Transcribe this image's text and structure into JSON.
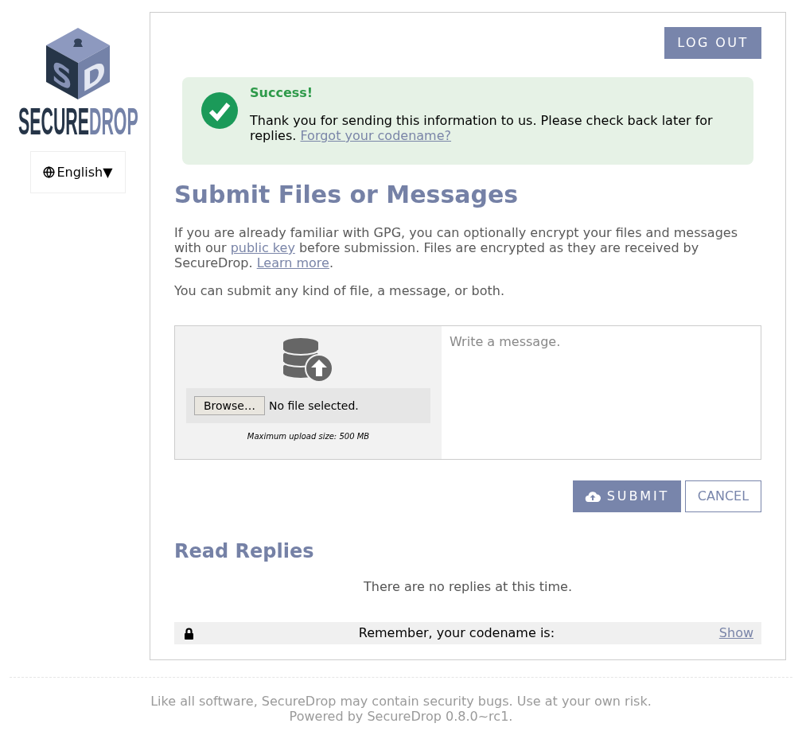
{
  "sidebar": {
    "logo": {
      "cube_letters": [
        "S",
        "D"
      ],
      "wordmark": [
        "SECURE",
        "DROP"
      ]
    },
    "language_menu": {
      "label": "English",
      "caret": "▼"
    }
  },
  "header": {
    "logout_button": "LOG OUT"
  },
  "alert": {
    "kind": "success",
    "title": "Success!",
    "message": "Thank you for sending this information to us. Please check back later for replies.",
    "link": "Forgot your codename?"
  },
  "submit_section": {
    "heading": "Submit Files or Messages",
    "intro": [
      {
        "kind": "text",
        "text": "If you are already familiar with GPG, you can optionally encrypt your files and messages with our "
      },
      {
        "kind": "link",
        "text": "public key"
      },
      {
        "kind": "text",
        "text": " before submission. Files are encrypted as they are received by SecureDrop. "
      },
      {
        "kind": "link",
        "text": "Learn more"
      },
      {
        "kind": "text",
        "text": "."
      }
    ],
    "note": "You can submit any kind of file, a message, or both.",
    "file_picker": {
      "button": "Browse…",
      "status": "No file selected.",
      "limit": "Maximum upload size: 500 MB"
    },
    "message_field": {
      "placeholder": "Write a message."
    },
    "buttons": [
      {
        "kind": "primary",
        "label": "SUBMIT"
      },
      {
        "kind": "secondary",
        "label": "CANCEL"
      }
    ]
  },
  "replies_section": {
    "heading": "Read Replies",
    "empty_text": "There are no replies at this time.",
    "codename_bar": {
      "text": "Remember, your codename is:",
      "link": "Show"
    }
  },
  "footer": {
    "lines": [
      "Like all software, SecureDrop may contain security bugs. Use at your own risk.",
      "Powered by SecureDrop 0.8.0~rc1."
    ]
  }
}
